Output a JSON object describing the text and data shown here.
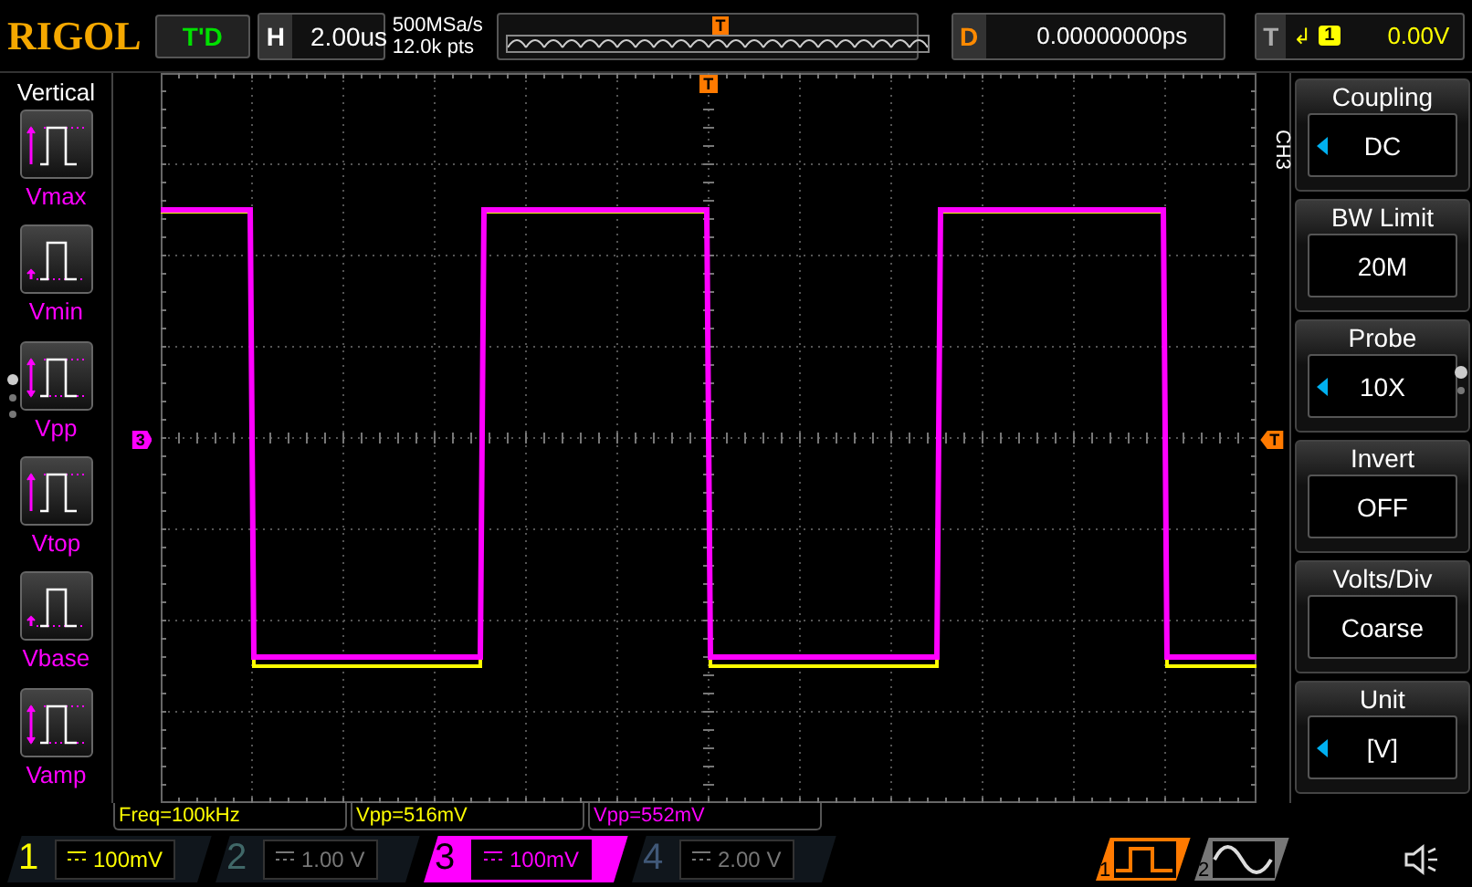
{
  "header": {
    "logo": "RIGOL",
    "trigger_status": "T'D",
    "timebase": {
      "label": "H",
      "value": "2.00us"
    },
    "sample_rate": "500MSa/s",
    "memory_depth": "12.0k pts",
    "memory_view": {
      "trigger_marker": "T"
    },
    "delay": {
      "label": "D",
      "value": "0.00000000ps"
    },
    "trigger": {
      "label": "T",
      "slope": "↲",
      "source": "1",
      "level": "0.00V"
    }
  },
  "left_menu": {
    "title": "Vertical",
    "items": [
      {
        "label": "Vmax",
        "kind": "vmax"
      },
      {
        "label": "Vmin",
        "kind": "vmin"
      },
      {
        "label": "Vpp",
        "kind": "vpp"
      },
      {
        "label": "Vtop",
        "kind": "vtop"
      },
      {
        "label": "Vbase",
        "kind": "vbase"
      },
      {
        "label": "Vamp",
        "kind": "vamp"
      }
    ]
  },
  "grid_markers": {
    "channel": "3",
    "trigger_position": "T",
    "trigger_level": "T"
  },
  "right_menu": {
    "channel_tab": "CH3",
    "items": [
      {
        "label": "Coupling",
        "value": "DC",
        "adjustable": true
      },
      {
        "label": "BW Limit",
        "value": "20M",
        "adjustable": false
      },
      {
        "label": "Probe",
        "value": "10X",
        "adjustable": true
      },
      {
        "label": "Invert",
        "value": "OFF",
        "adjustable": false
      },
      {
        "label": "Volts/Div",
        "value": "Coarse",
        "adjustable": false
      },
      {
        "label": "Unit",
        "value": "[V]",
        "adjustable": true
      }
    ]
  },
  "measurements": [
    {
      "text": "Freq=100kHz",
      "color": "#ffff00"
    },
    {
      "text": "Vpp=516mV",
      "color": "#ffff00"
    },
    {
      "text": "Vpp=552mV",
      "color": "#ff00ff"
    }
  ],
  "channels": [
    {
      "number": "1",
      "scale": "100mV",
      "on": true,
      "selected": false,
      "color": "#ffff00"
    },
    {
      "number": "2",
      "scale": "1.00 V",
      "on": false,
      "selected": false,
      "color": "#406868"
    },
    {
      "number": "3",
      "scale": "100mV",
      "on": true,
      "selected": true,
      "color": "#ff00ff"
    },
    {
      "number": "4",
      "scale": "2.00 V",
      "on": false,
      "selected": false,
      "color": "#405878"
    }
  ],
  "trigger_buttons": [
    {
      "number": "1",
      "kind": "square",
      "selected": true
    },
    {
      "number": "2",
      "kind": "sine",
      "selected": false
    }
  ]
}
